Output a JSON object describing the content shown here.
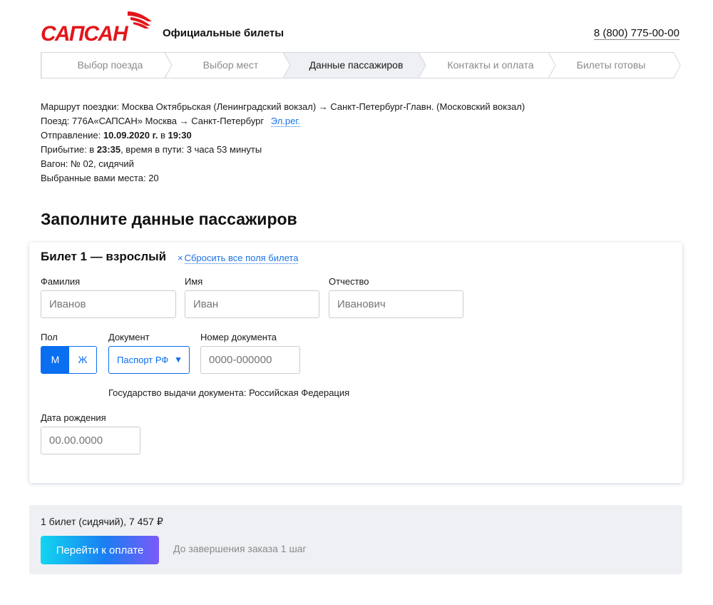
{
  "header": {
    "logo_text": "САПСАН",
    "title": "Официальные билеты",
    "phone": "8 (800) 775-00-00"
  },
  "stepper": {
    "steps": [
      {
        "label": "Выбор поезда",
        "active": false
      },
      {
        "label": "Выбор мест",
        "active": false
      },
      {
        "label": "Данные пассажиров",
        "active": true
      },
      {
        "label": "Контакты и оплата",
        "active": false
      },
      {
        "label": "Билеты готовы",
        "active": false
      }
    ]
  },
  "trip": {
    "route_label": "Маршрут поездки:",
    "route_value": "Москва Октябрьская (Ленинградский вокзал) → Санкт-Петербург-Главн. (Московский вокзал)",
    "train_label": "Поезд:",
    "train_value": "776А«САПСАН» Москва → Санкт-Петербург",
    "ereg_link": "Эл.рег.",
    "departure_label": "Отправление:",
    "departure_date": "10.09.2020 г.",
    "departure_in": "в",
    "departure_time": "19:30",
    "arrival_label": "Прибытие: в",
    "arrival_time": "23:35",
    "travel_time": ", время в пути: 3 часа 53 минуты",
    "car": "Вагон: № 02, сидячий",
    "seats": "Выбранные вами места: 20"
  },
  "page_heading": "Заполните данные пассажиров",
  "ticket": {
    "title": "Билет 1 — взрослый",
    "reset_icon": "×",
    "reset_label": "Сбросить все поля билета",
    "surname_label": "Фамилия",
    "surname_placeholder": "Иванов",
    "name_label": "Имя",
    "name_placeholder": "Иван",
    "patronymic_label": "Отчество",
    "patronymic_placeholder": "Иванович",
    "gender_label": "Пол",
    "gender_male": "М",
    "gender_female": "Ж",
    "gender_selected": "М",
    "document_label": "Документ",
    "document_value": "Паспорт РФ",
    "document_arrow": "▼",
    "doc_number_label": "Номер документа",
    "doc_number_placeholder": "0000-000000",
    "issuer": "Государство выдачи документа: Российская Федерация",
    "birth_label": "Дата рождения",
    "birth_placeholder": "00.00.0000"
  },
  "summary": {
    "text": "1 билет (сидячий), 7 457 ₽",
    "pay_button": "Перейти к оплате",
    "steps_left": "До завершения заказа 1 шаг"
  },
  "colors": {
    "accent": "#0a6ef0",
    "link": "#1a73e8",
    "brand_red": "#e3161b"
  }
}
